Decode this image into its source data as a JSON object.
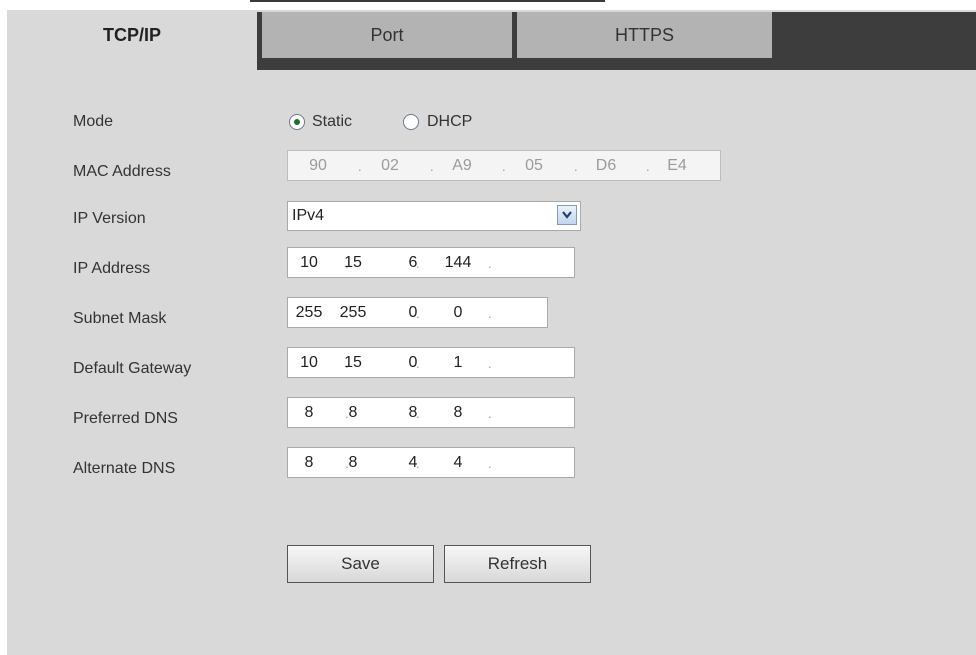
{
  "tabs": [
    {
      "label": "TCP/IP",
      "active": true
    },
    {
      "label": "Port",
      "active": false
    },
    {
      "label": "HTTPS",
      "active": false
    }
  ],
  "form": {
    "mode": {
      "label": "Mode",
      "options": [
        "Static",
        "DHCP"
      ],
      "selected": "Static"
    },
    "mac_address": {
      "label": "MAC Address",
      "octets": [
        "90",
        "02",
        "A9",
        "05",
        "D6",
        "E4"
      ]
    },
    "ip_version": {
      "label": "IP Version",
      "value": "IPv4"
    },
    "ip_address": {
      "label": "IP Address",
      "octets": [
        "10",
        "15",
        "6",
        "144"
      ]
    },
    "subnet_mask": {
      "label": "Subnet Mask",
      "octets": [
        "255",
        "255",
        "0",
        "0"
      ]
    },
    "default_gateway": {
      "label": "Default Gateway",
      "octets": [
        "10",
        "15",
        "0",
        "1"
      ]
    },
    "preferred_dns": {
      "label": "Preferred DNS",
      "octets": [
        "8",
        "8",
        "8",
        "8"
      ]
    },
    "alternate_dns": {
      "label": "Alternate DNS",
      "octets": [
        "8",
        "8",
        "4",
        "4"
      ]
    }
  },
  "buttons": {
    "save": "Save",
    "refresh": "Refresh"
  },
  "colors": {
    "panel_bg": "#d9d9d9",
    "tab_bar_bg": "#3d3d3d",
    "inactive_tab": "#b3b3b3",
    "radio_selected": "#1e6e2a"
  }
}
